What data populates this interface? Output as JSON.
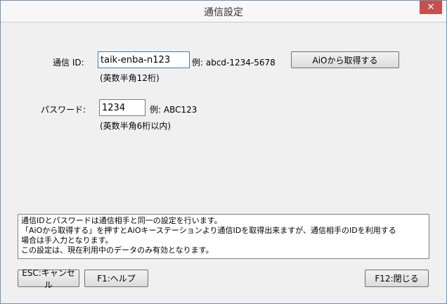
{
  "window": {
    "title": "通信設定",
    "close_label": "✕"
  },
  "comm_id": {
    "label": "通信 ID:",
    "value": "taik-enba-n123",
    "example": "例: abcd-1234-5678",
    "hint": "(英数半角12桁)"
  },
  "fetch_button": {
    "label": "AiOから取得する"
  },
  "password": {
    "label": "パスワード:",
    "value": "1234",
    "example": "例: ABC123",
    "hint": "(英数半角6桁以内)"
  },
  "notes": [
    "通信IDとパスワードは通信相手と同一の設定を行います。",
    "「AiOから取得する」を押すとAiOキーステーションより通信IDを取得出来ますが、通信相手のIDを利用する",
    "場合は手入力となります。",
    "この設定は、現在利用中のデータのみ有効となります。"
  ],
  "footer": {
    "esc_label": "ESC:キャンセル",
    "f1_label": "F1:ヘルプ",
    "f12_label": "F12:閉じる"
  },
  "colors": {
    "close_button": "#c7504a",
    "focus_border": "#3c7fb1"
  }
}
